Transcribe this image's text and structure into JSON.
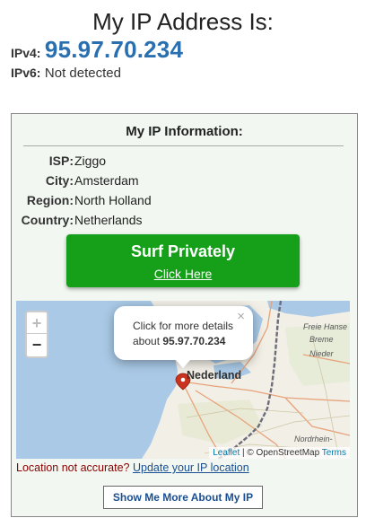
{
  "header": {
    "title": "My IP Address Is:",
    "ipv4_label": "IPv4:",
    "ipv4_value": "95.97.70.234",
    "ipv6_label": "IPv6:",
    "ipv6_value": "Not detected"
  },
  "panel": {
    "heading": "My IP Information:",
    "rows": [
      {
        "key": "ISP:",
        "value": "Ziggo"
      },
      {
        "key": "City:",
        "value": "Amsterdam"
      },
      {
        "key": "Region:",
        "value": "North Holland"
      },
      {
        "key": "Country:",
        "value": "Netherlands"
      }
    ],
    "surf_button": {
      "title": "Surf Privately",
      "link": "Click Here"
    },
    "accuracy": {
      "text": "Location not accurate?",
      "link": "Update your IP location"
    },
    "more_button": "Show Me More About My IP"
  },
  "map": {
    "zoom_in": "+",
    "zoom_out": "−",
    "popup_line1": "Click for more details",
    "popup_line2_prefix": "about",
    "popup_ip": "95.97.70.234",
    "popup_close": "×",
    "country_label": "Nederland",
    "region_labels": [
      "Freie Hanse",
      "Breme",
      "Nieder",
      "Nordrhein-"
    ],
    "attribution_leaflet": "Leaflet",
    "attribution_sep": "|",
    "attribution_osm": "© OpenStreetMap",
    "attribution_terms": "Terms",
    "colors": {
      "water": "#a9c9e6",
      "land": "#f1efe6",
      "border": "#6d6d7a",
      "marker": "#c9341f"
    }
  }
}
